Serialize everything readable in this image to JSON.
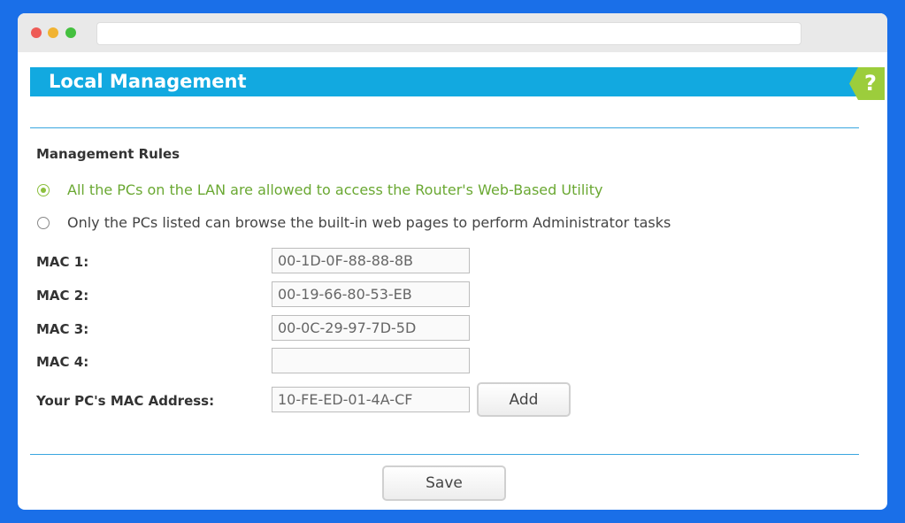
{
  "page": {
    "title": "Local Management",
    "help_label": "?"
  },
  "management_rules": {
    "title": "Management Rules",
    "options": [
      {
        "label": "All the PCs on the LAN are allowed to access the Router's Web-Based Utility",
        "selected": true
      },
      {
        "label": "Only the PCs listed can browse the built-in web pages to perform Administrator tasks",
        "selected": false
      }
    ]
  },
  "mac_entries": [
    {
      "label": "MAC 1:",
      "value": "00-1D-0F-88-88-8B"
    },
    {
      "label": "MAC 2:",
      "value": "00-19-66-80-53-EB"
    },
    {
      "label": "MAC 3:",
      "value": "00-0C-29-97-7D-5D"
    },
    {
      "label": "MAC 4:",
      "value": ""
    }
  ],
  "your_pc": {
    "label": "Your PC's MAC Address:",
    "value": "10-FE-ED-01-4A-CF",
    "add_label": "Add"
  },
  "actions": {
    "save_label": "Save"
  },
  "colors": {
    "header": "#12a9e0",
    "help_tab": "#9ccd3c",
    "selected_option": "#6aa832",
    "background": "#1a6fe8"
  }
}
